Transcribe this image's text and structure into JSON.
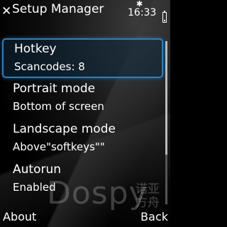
{
  "title": "Setup Manager",
  "status": {
    "time": "16:33",
    "bluetooth_icon": "bluetooth-icon"
  },
  "items": [
    {
      "label": "Hotkey",
      "value": "Scancodes: 8",
      "selected": true
    },
    {
      "label": "Portrait mode",
      "value": "Bottom of screen",
      "selected": false
    },
    {
      "label": "Landscape mode",
      "value": "Above\"softkeys\"\"",
      "selected": false
    },
    {
      "label": "Autorun",
      "value": "Enabled",
      "selected": false
    }
  ],
  "watermark": {
    "text": "Dospy",
    "cn": "诺亚方舟"
  },
  "softkeys": {
    "left": "About",
    "right": "Back"
  },
  "colors": {
    "accent": "#2a7fbf",
    "background": "#000000",
    "text": "#ffffff"
  }
}
